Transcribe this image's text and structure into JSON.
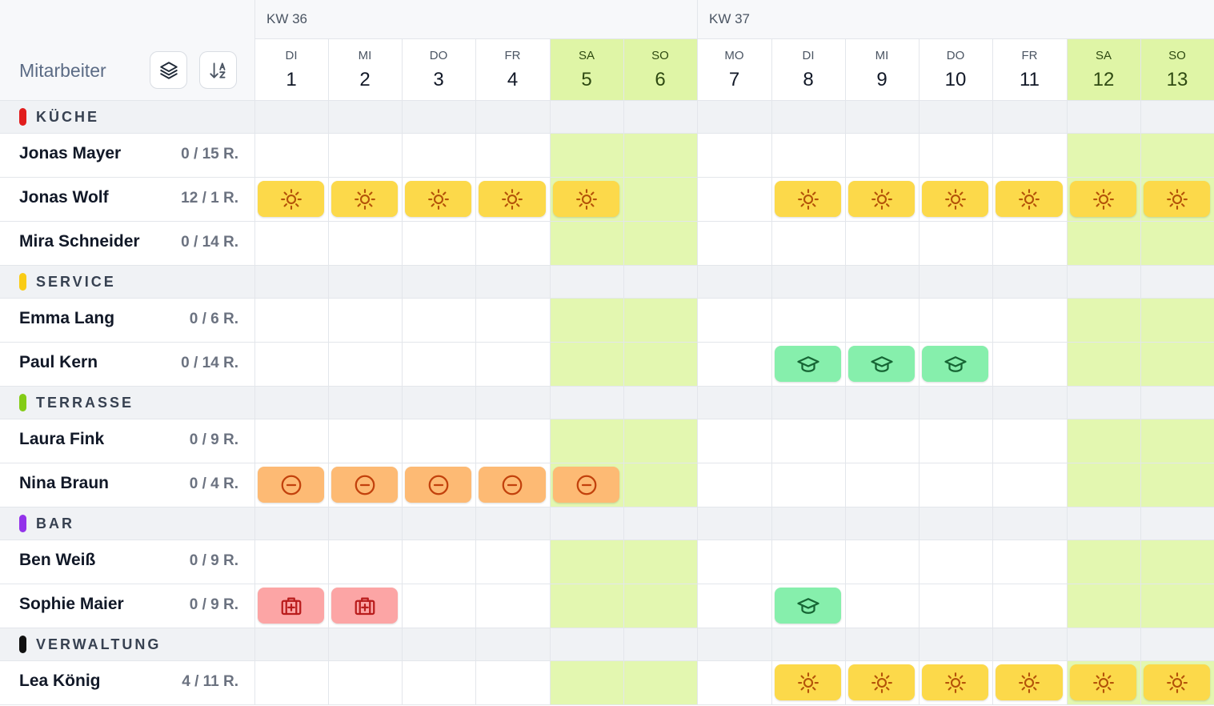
{
  "header": {
    "column_label": "Mitarbeiter",
    "layers_button_icon": "layers-icon",
    "sort_button_icon": "sort-alpha-icon",
    "weeks": [
      {
        "label": "KW 36"
      },
      {
        "label": "KW 37"
      }
    ],
    "days": [
      {
        "name": "DI",
        "num": "1",
        "weekend": false
      },
      {
        "name": "MI",
        "num": "2",
        "weekend": false
      },
      {
        "name": "DO",
        "num": "3",
        "weekend": false
      },
      {
        "name": "FR",
        "num": "4",
        "weekend": false
      },
      {
        "name": "SA",
        "num": "5",
        "weekend": true
      },
      {
        "name": "SO",
        "num": "6",
        "weekend": true
      },
      {
        "name": "MO",
        "num": "7",
        "weekend": false
      },
      {
        "name": "DI",
        "num": "8",
        "weekend": false
      },
      {
        "name": "MI",
        "num": "9",
        "weekend": false
      },
      {
        "name": "DO",
        "num": "10",
        "weekend": false
      },
      {
        "name": "FR",
        "num": "11",
        "weekend": false
      },
      {
        "name": "SA",
        "num": "12",
        "weekend": true
      },
      {
        "name": "SO",
        "num": "13",
        "weekend": true
      }
    ]
  },
  "colors": {
    "weekend_bg": "#e3f7b0",
    "weekend_header_bg": "#dff5a6",
    "group_row_bg": "#f0f2f5",
    "vacation_bg": "#fcd94a",
    "vacation_icon": "#b45309",
    "training_bg": "#86efac",
    "training_icon": "#166534",
    "absence_bg": "#fdba74",
    "absence_icon": "#c2410c",
    "sick_bg": "#fca5a5",
    "sick_icon": "#b91c1c"
  },
  "legend_types": {
    "vacation": {
      "icon": "sun-icon"
    },
    "training": {
      "icon": "graduation-cap-icon"
    },
    "absence": {
      "icon": "minus-circle-icon"
    },
    "sick": {
      "icon": "first-aid-kit-icon"
    }
  },
  "groups": [
    {
      "label": "KÜCHE",
      "color": "#e11d1d",
      "employees": [
        {
          "name": "Jonas Mayer",
          "count": "0 / 15 R.",
          "absences": []
        },
        {
          "name": "Jonas Wolf",
          "count": "12 / 1 R.",
          "absences": [
            {
              "day": 0,
              "type": "vacation"
            },
            {
              "day": 1,
              "type": "vacation"
            },
            {
              "day": 2,
              "type": "vacation"
            },
            {
              "day": 3,
              "type": "vacation"
            },
            {
              "day": 4,
              "type": "vacation"
            },
            {
              "day": 7,
              "type": "vacation"
            },
            {
              "day": 8,
              "type": "vacation"
            },
            {
              "day": 9,
              "type": "vacation"
            },
            {
              "day": 10,
              "type": "vacation"
            },
            {
              "day": 11,
              "type": "vacation"
            },
            {
              "day": 12,
              "type": "vacation"
            }
          ]
        },
        {
          "name": "Mira Schneider",
          "count": "0 / 14 R.",
          "absences": []
        }
      ]
    },
    {
      "label": "SERVICE",
      "color": "#facc15",
      "employees": [
        {
          "name": "Emma Lang",
          "count": "0 / 6 R.",
          "absences": []
        },
        {
          "name": "Paul Kern",
          "count": "0 / 14 R.",
          "absences": [
            {
              "day": 7,
              "type": "training"
            },
            {
              "day": 8,
              "type": "training"
            },
            {
              "day": 9,
              "type": "training"
            }
          ]
        }
      ]
    },
    {
      "label": "TERRASSE",
      "color": "#84cc16",
      "employees": [
        {
          "name": "Laura Fink",
          "count": "0 / 9 R.",
          "absences": []
        },
        {
          "name": "Nina Braun",
          "count": "0 / 4 R.",
          "absences": [
            {
              "day": 0,
              "type": "absence"
            },
            {
              "day": 1,
              "type": "absence"
            },
            {
              "day": 2,
              "type": "absence"
            },
            {
              "day": 3,
              "type": "absence"
            },
            {
              "day": 4,
              "type": "absence"
            }
          ]
        }
      ]
    },
    {
      "label": "BAR",
      "color": "#9333ea",
      "employees": [
        {
          "name": "Ben Weiß",
          "count": "0 / 9 R.",
          "absences": []
        },
        {
          "name": "Sophie Maier",
          "count": "0 / 9 R.",
          "absences": [
            {
              "day": 0,
              "type": "sick"
            },
            {
              "day": 1,
              "type": "sick"
            },
            {
              "day": 7,
              "type": "training"
            }
          ]
        }
      ]
    },
    {
      "label": "VERWALTUNG",
      "color": "#111111",
      "employees": [
        {
          "name": "Lea König",
          "count": "4 / 11 R.",
          "absences": [
            {
              "day": 7,
              "type": "vacation"
            },
            {
              "day": 8,
              "type": "vacation"
            },
            {
              "day": 9,
              "type": "vacation"
            },
            {
              "day": 10,
              "type": "vacation"
            },
            {
              "day": 11,
              "type": "vacation"
            },
            {
              "day": 12,
              "type": "vacation"
            }
          ]
        }
      ]
    }
  ]
}
